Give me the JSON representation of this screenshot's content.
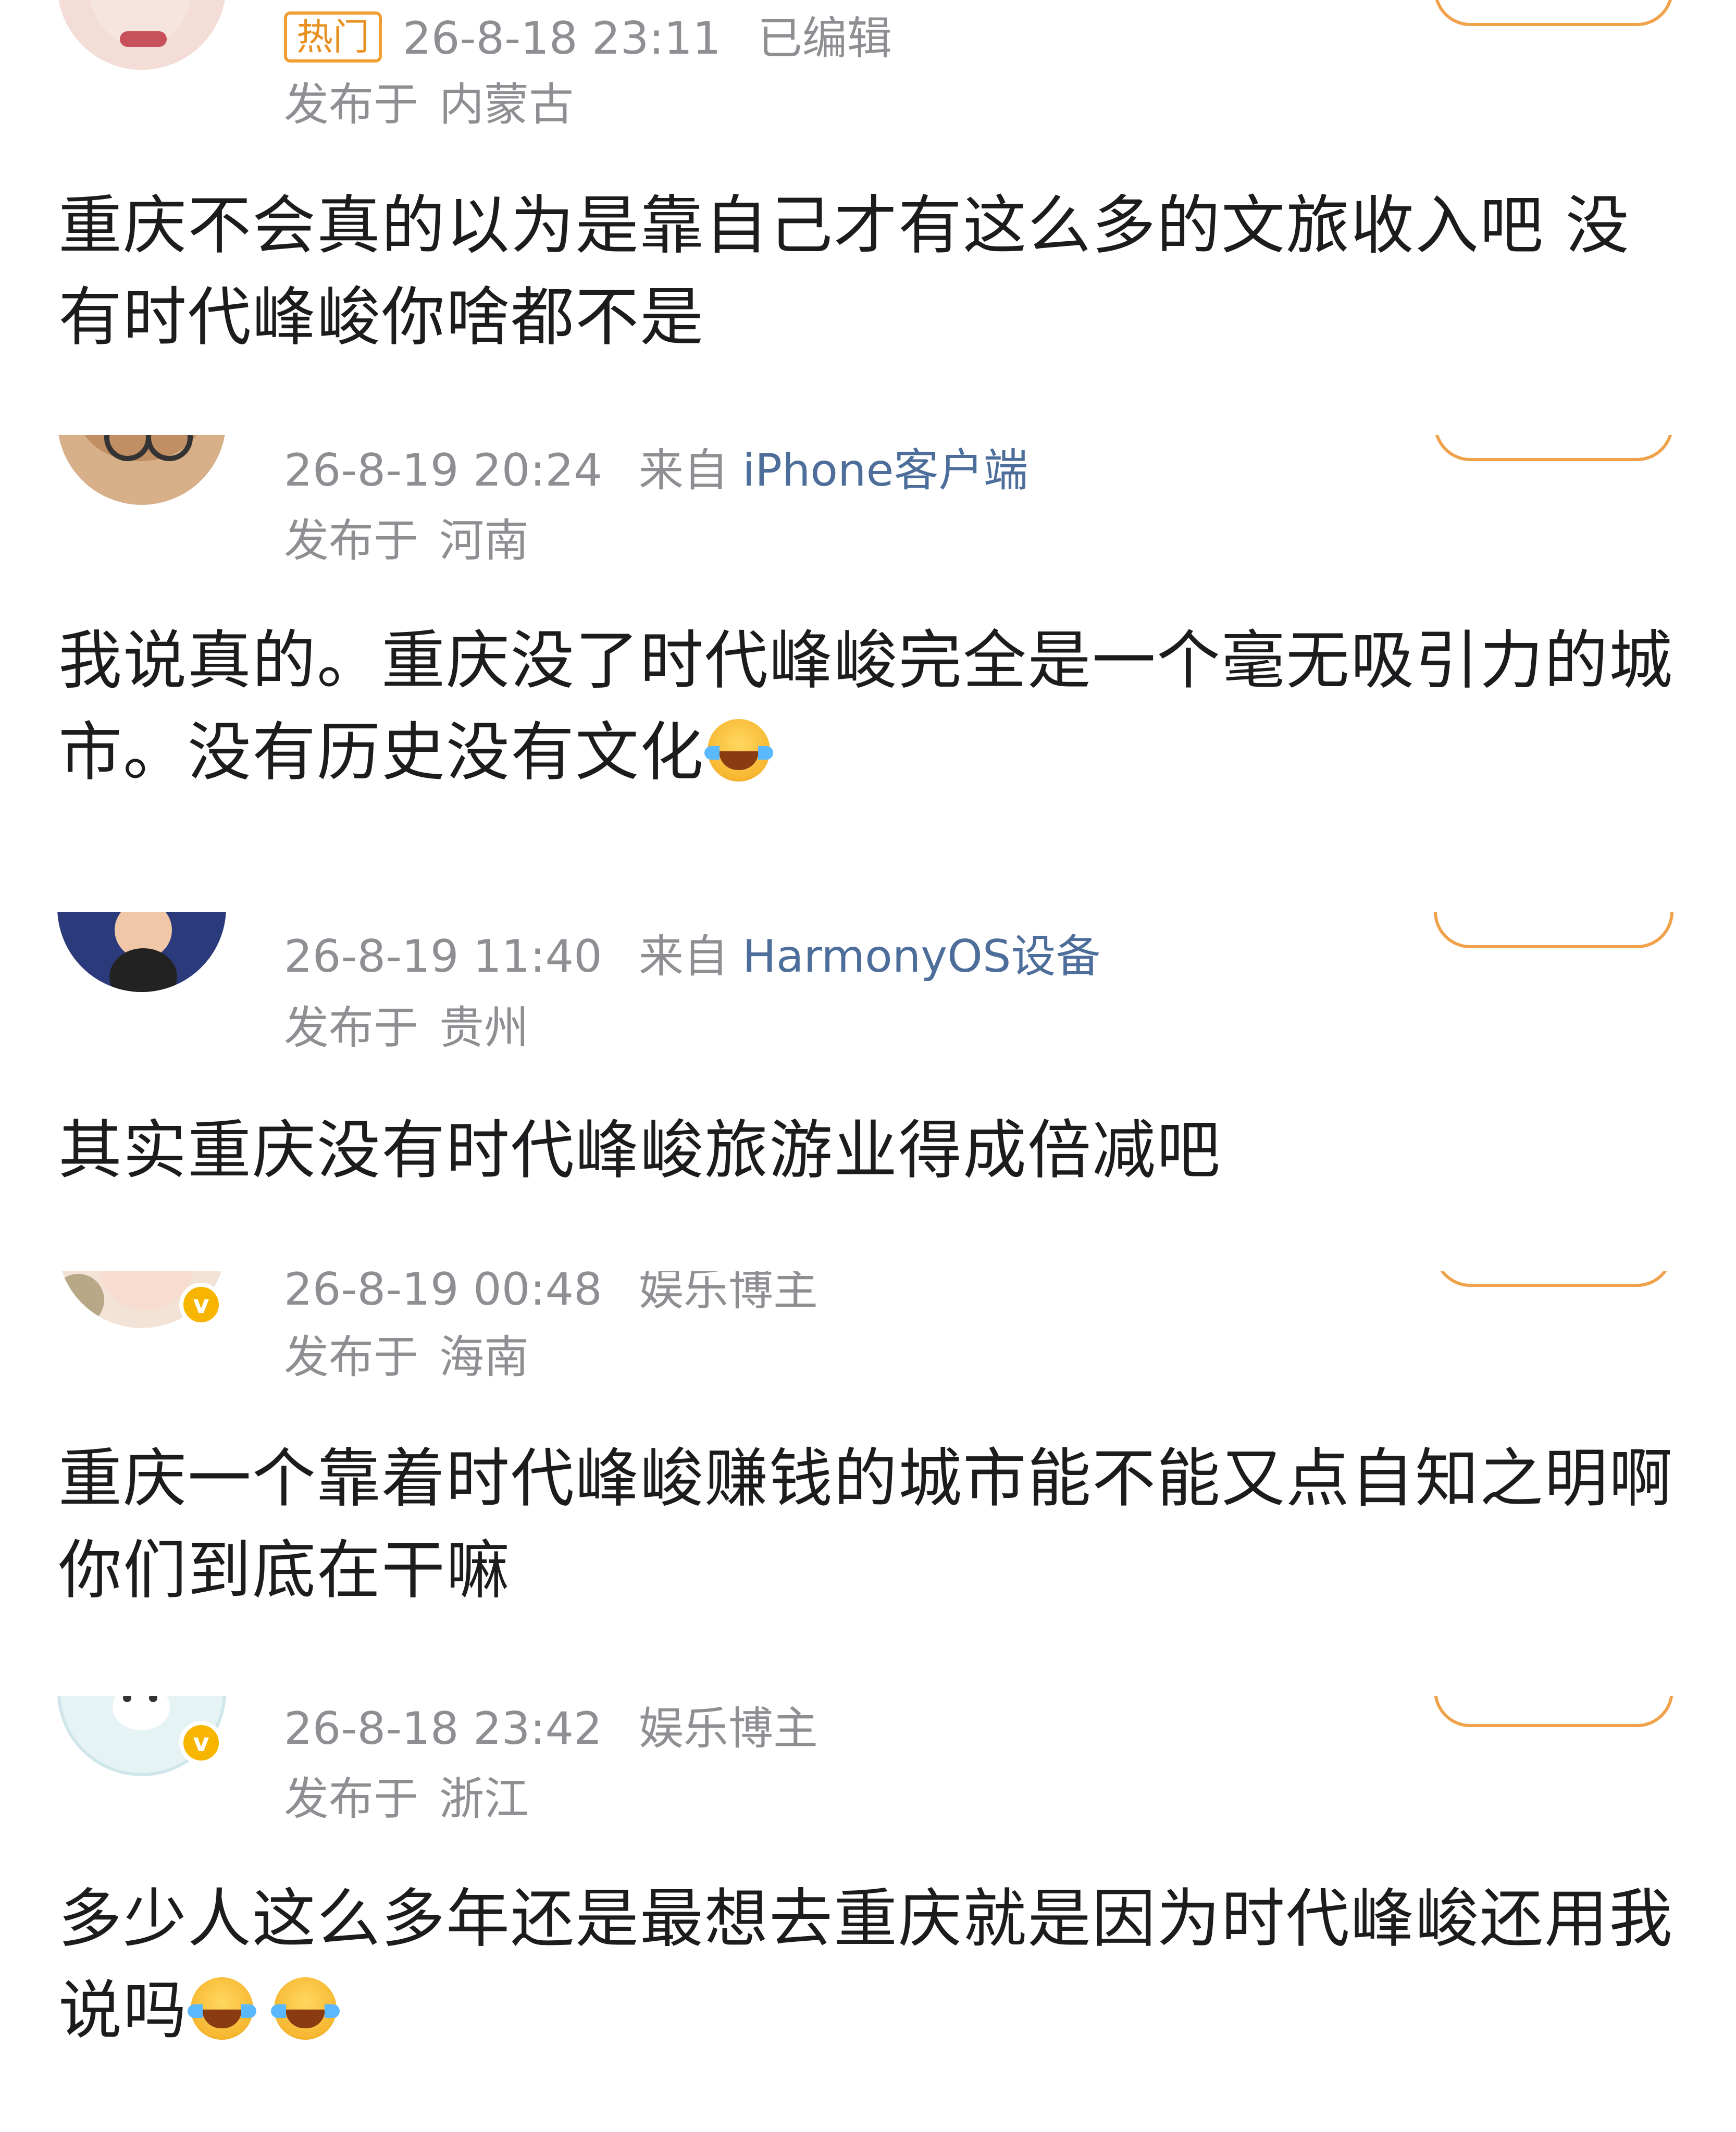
{
  "comments": [
    {
      "hot_tag": "热门",
      "datetime": "26-8-18 23:11",
      "extra": "已编辑",
      "location_prefix": "发布于",
      "location": "内蒙古",
      "text": "重庆不会真的以为是靠自己才有这么多的文旅收入吧 没有时代峰峻你啥都不是"
    },
    {
      "datetime": "26-8-19 20:24",
      "source_prefix": "来自",
      "device": "iPhone客户端",
      "location_prefix": "发布于",
      "location": "河南",
      "text": "我说真的。重庆没了时代峰峻完全是一个毫无吸引力的城市。没有历史没有文化",
      "emoji_count": 1
    },
    {
      "datetime": "26-8-19 11:40",
      "source_prefix": "来自",
      "device": "HarmonyOS设备",
      "location_prefix": "发布于",
      "location": "贵州",
      "text": "其实重庆没有时代峰峻旅游业得成倍减吧"
    },
    {
      "datetime": "26-8-19 00:48",
      "role": "娱乐博主",
      "location_prefix": "发布于",
      "location": "海南",
      "text": "重庆一个靠着时代峰峻赚钱的城市能不能又点自知之明啊 你们到底在干嘛"
    },
    {
      "datetime": "26-8-18 23:42",
      "role": "娱乐博主",
      "location_prefix": "发布于",
      "location": "浙江",
      "text": "多少人这么多年还是最想去重庆就是因为时代峰峻还用我说吗",
      "emoji_count": 2
    }
  ],
  "verified_badge": "v",
  "colors": {
    "meta": "#8e8e93",
    "device_link": "#4d6e9a",
    "hot": "#e89020",
    "follow_border": "#f0a24a",
    "verified": "#f7b500"
  }
}
